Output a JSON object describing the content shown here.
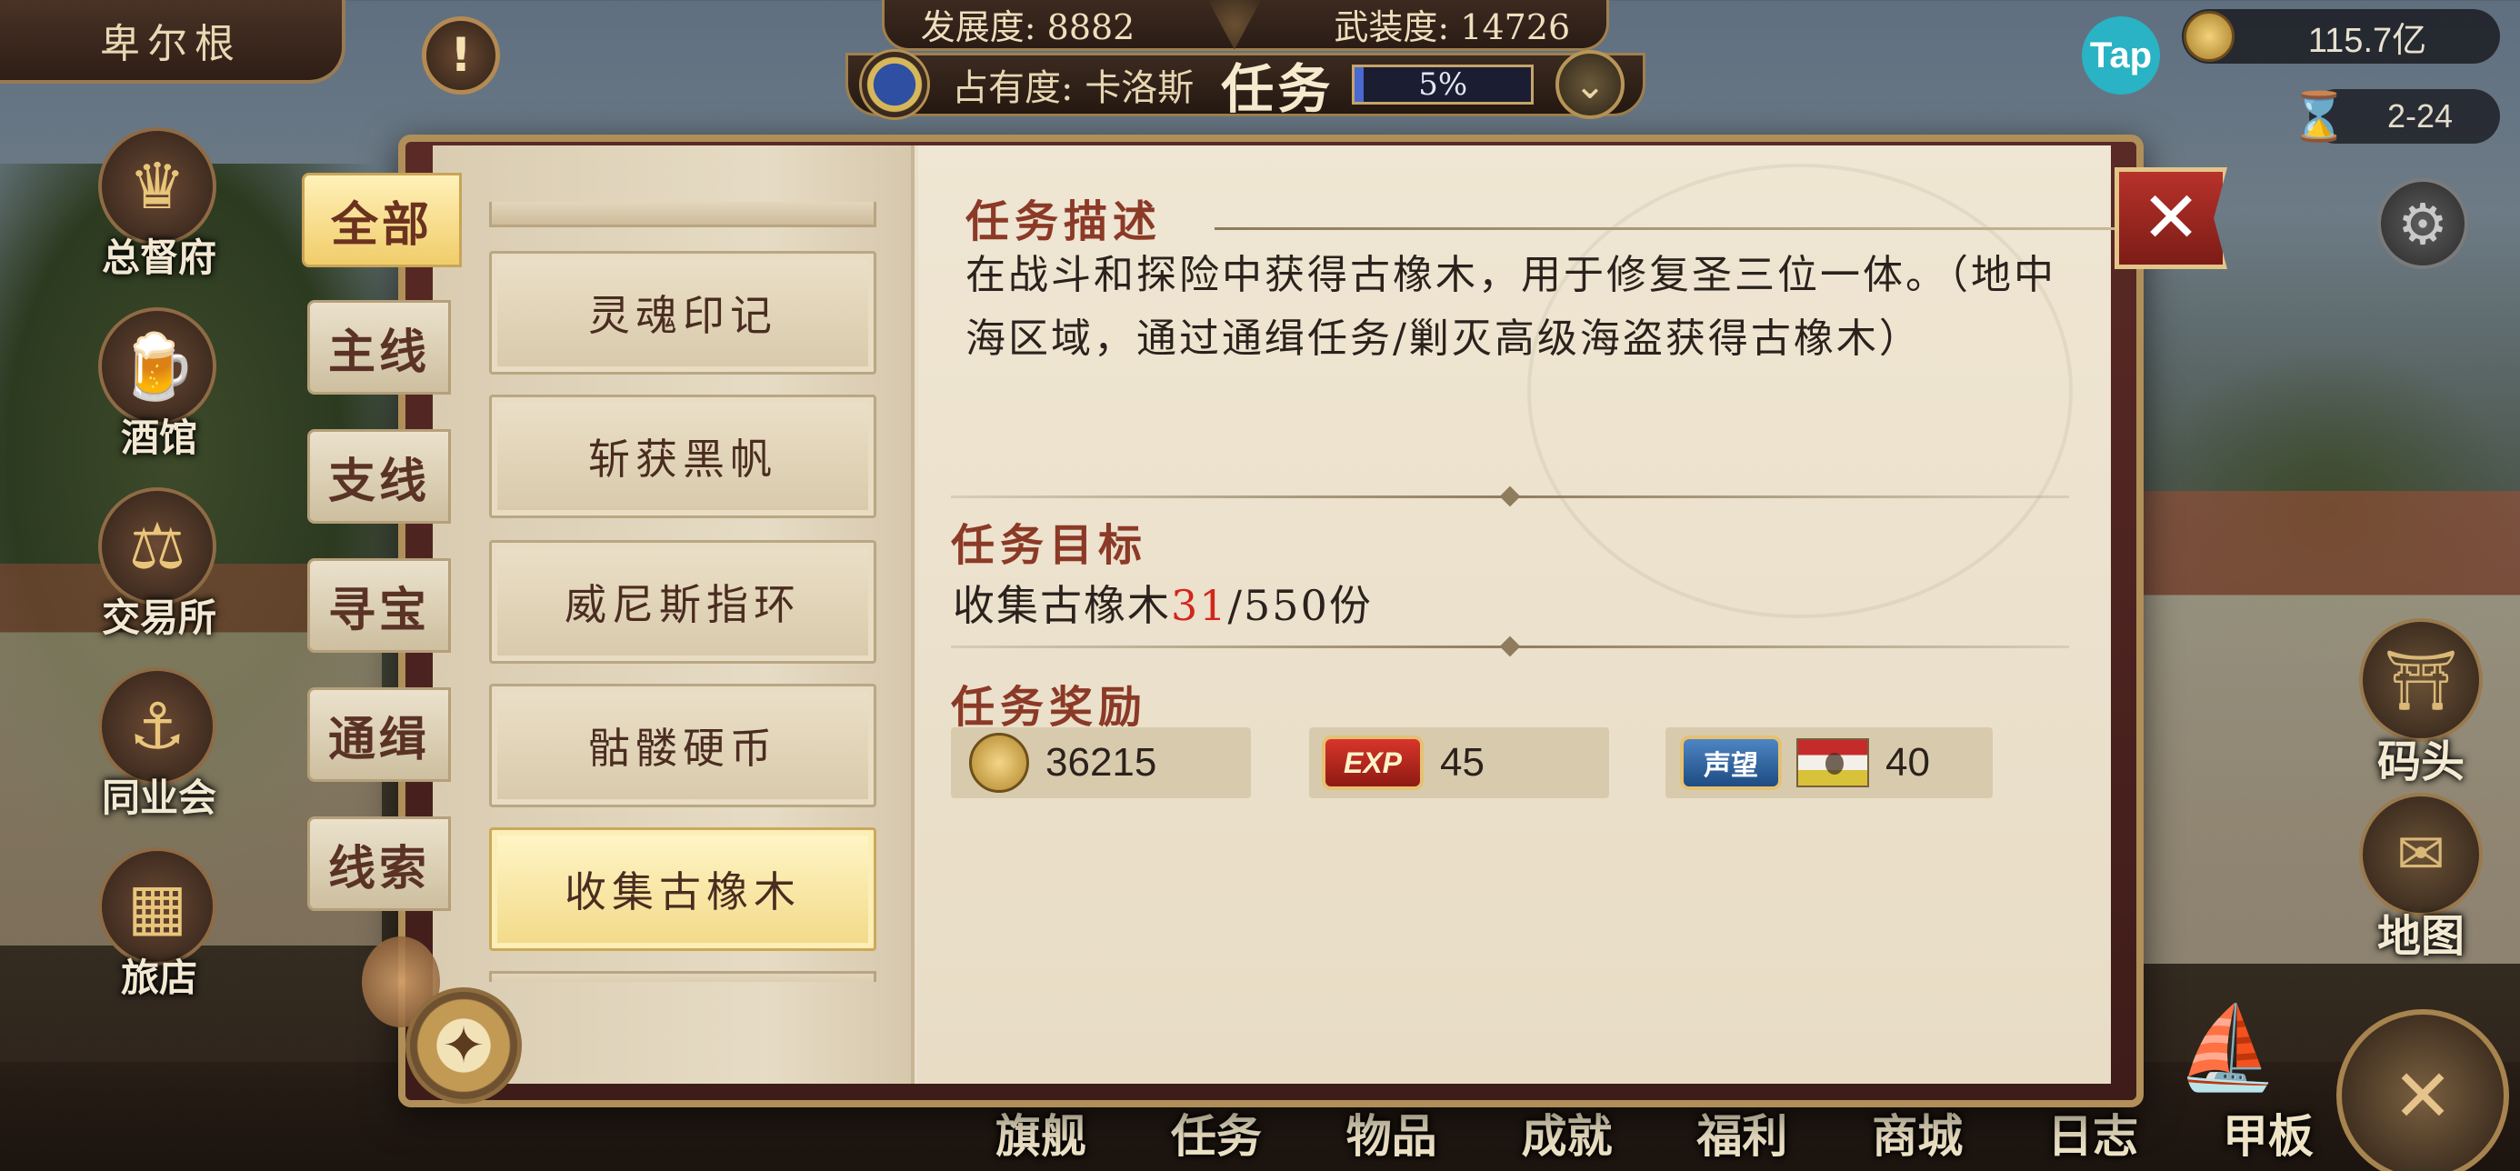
{
  "city": {
    "name": "卑尔根"
  },
  "top_stats": {
    "development_label": "发展度: 8882",
    "armament_label": "武装度: 14726",
    "occupancy_label": "占有度: 卡洛斯",
    "task_word": "任务",
    "occupancy_percent": "5%",
    "occupancy_fraction": 0.05
  },
  "currency": {
    "gold": "115.7亿",
    "date": "2-24",
    "tap_logo": "Tap"
  },
  "left_buildings": [
    {
      "label": "总督府",
      "icon": "crown-icon"
    },
    {
      "label": "酒馆",
      "icon": "beer-mug-icon"
    },
    {
      "label": "交易所",
      "icon": "scales-icon"
    },
    {
      "label": "同业会",
      "icon": "anchor-shield-icon"
    },
    {
      "label": "旅店",
      "icon": "basket-icon"
    }
  ],
  "right_buttons": [
    {
      "label": "码头",
      "icon": "dock-icon"
    },
    {
      "label": "地图",
      "icon": "map-scroll-icon"
    }
  ],
  "bottom_nav": [
    "旗舰",
    "任务",
    "物品",
    "成就",
    "福利",
    "商城",
    "日志",
    "甲板"
  ],
  "category_tabs": [
    "全部",
    "主线",
    "支线",
    "寻宝",
    "通缉",
    "线索"
  ],
  "active_category": "全部",
  "quests": [
    "灵魂印记",
    "斩获黑帆",
    "威尼斯指环",
    "骷髅硬币",
    "收集古橡木"
  ],
  "active_quest": "收集古橡木",
  "detail": {
    "description_title": "任务描述",
    "description_text": "在战斗和探险中获得古橡木，用于修复圣三位一体。（地中海区域，通过通缉任务/剿灭高级海盗获得古橡木）",
    "goal_title": "任务目标",
    "goal_prefix": "收集古橡木",
    "goal_current": "31",
    "goal_suffix": "/550份",
    "reward_title": "任务奖励",
    "rewards": {
      "gold": "36215",
      "exp_badge": "EXP",
      "exp": "45",
      "reputation_badge": "声望",
      "reputation": "40"
    }
  },
  "colors": {
    "accent_red": "#8b3a27",
    "progress_blue": "#4a6ad1",
    "highlight_gold": "#f2d987",
    "goal_current_red": "#d2261c"
  }
}
